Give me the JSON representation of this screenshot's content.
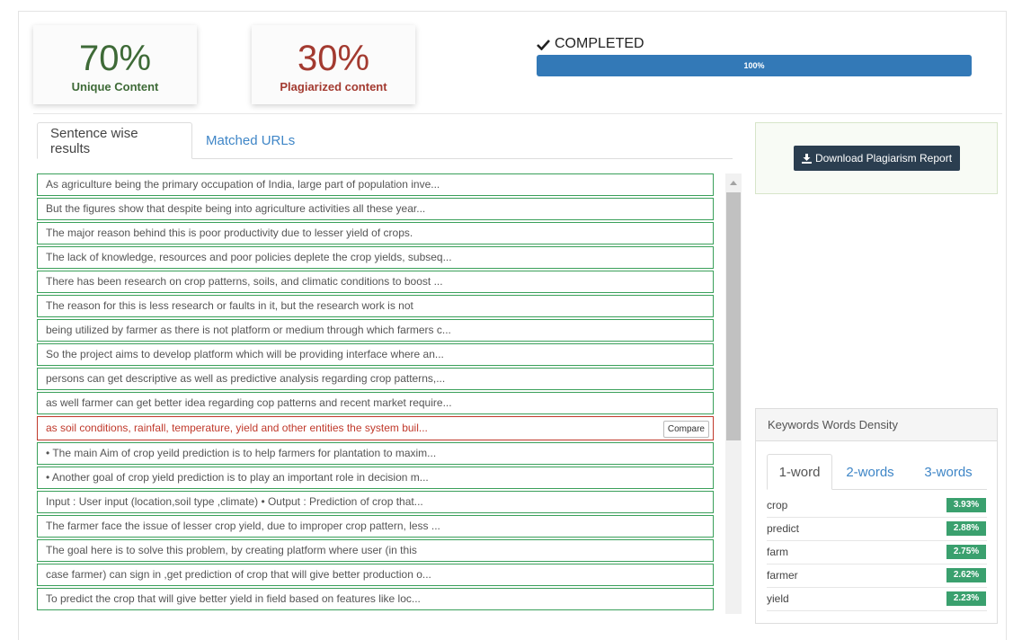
{
  "summary": {
    "unique_pct": "70%",
    "unique_label": "Unique Content",
    "plag_pct": "30%",
    "plag_label": "Plagiarized content"
  },
  "status": {
    "text": "COMPLETED",
    "progress_label": "100%",
    "progress_value": 1.0
  },
  "tabs": {
    "sentence": "Sentence wise results",
    "matched": "Matched URLs"
  },
  "sentences": [
    {
      "text": "As agriculture being the primary occupation of India, large part of population inve...",
      "plagiarized": false
    },
    {
      "text": "But the figures show that despite being into agriculture activities all these year...",
      "plagiarized": false
    },
    {
      "text": "The major reason behind this is poor productivity due to lesser yield of crops.",
      "plagiarized": false
    },
    {
      "text": "The lack of knowledge, resources and poor policies deplete the crop yields, subseq...",
      "plagiarized": false
    },
    {
      "text": "There has been research on crop patterns, soils, and climatic conditions to boost ...",
      "plagiarized": false
    },
    {
      "text": "The reason for this is less research or faults in it, but the research work is not",
      "plagiarized": false
    },
    {
      "text": "being utilized by farmer as there is not platform or medium through which farmers c...",
      "plagiarized": false
    },
    {
      "text": "So the project aims to develop platform which will be providing interface where an...",
      "plagiarized": false
    },
    {
      "text": "persons can get descriptive as well as predictive analysis regarding crop patterns,...",
      "plagiarized": false
    },
    {
      "text": "as well farmer can get better idea regarding cop patterns and recent market require...",
      "plagiarized": false
    },
    {
      "text": "as soil conditions, rainfall, temperature, yield and other entities the system buil...",
      "plagiarized": true
    },
    {
      "text": "• The main Aim of crop yeild prediction is to help farmers for plantation to maxim...",
      "plagiarized": false
    },
    {
      "text": "• Another goal of crop yield prediction is to play an important role in decision m...",
      "plagiarized": false
    },
    {
      "text": "Input : User input (location,soil type ,climate) • Output : Prediction of crop that...",
      "plagiarized": false
    },
    {
      "text": "The farmer face the issue of lesser crop yield, due to improper crop pattern, less ...",
      "plagiarized": false
    },
    {
      "text": "The goal here is to solve this problem, by creating platform where user (in this",
      "plagiarized": false
    },
    {
      "text": "case farmer) can sign in ,get prediction of crop that will give better production o...",
      "plagiarized": false
    },
    {
      "text": "To predict the crop that will give better yield in field based on features like loc...",
      "plagiarized": false
    }
  ],
  "compare_label": "Compare",
  "download_label": "Download Plagiarism Report",
  "keywords": {
    "title": "Keywords Words Density",
    "tabs": [
      "1-word",
      "2-words",
      "3-words"
    ],
    "rows": [
      {
        "word": "crop",
        "density": "3.93%"
      },
      {
        "word": "predict",
        "density": "2.88%"
      },
      {
        "word": "farm",
        "density": "2.75%"
      },
      {
        "word": "farmer",
        "density": "2.62%"
      },
      {
        "word": "yield",
        "density": "2.23%"
      }
    ]
  },
  "colors": {
    "unique": "#3e6a37",
    "plagiarized": "#a33a30",
    "progress": "#3379b7",
    "sentence_ok_border": "#3aa05a",
    "sentence_plag_border": "#c0392b",
    "badge": "#3aa06e",
    "download_button": "#2b3e50"
  },
  "icons": {
    "status": "check-icon",
    "download": "download-icon",
    "scroll_up": "scroll-up-arrow-icon"
  }
}
